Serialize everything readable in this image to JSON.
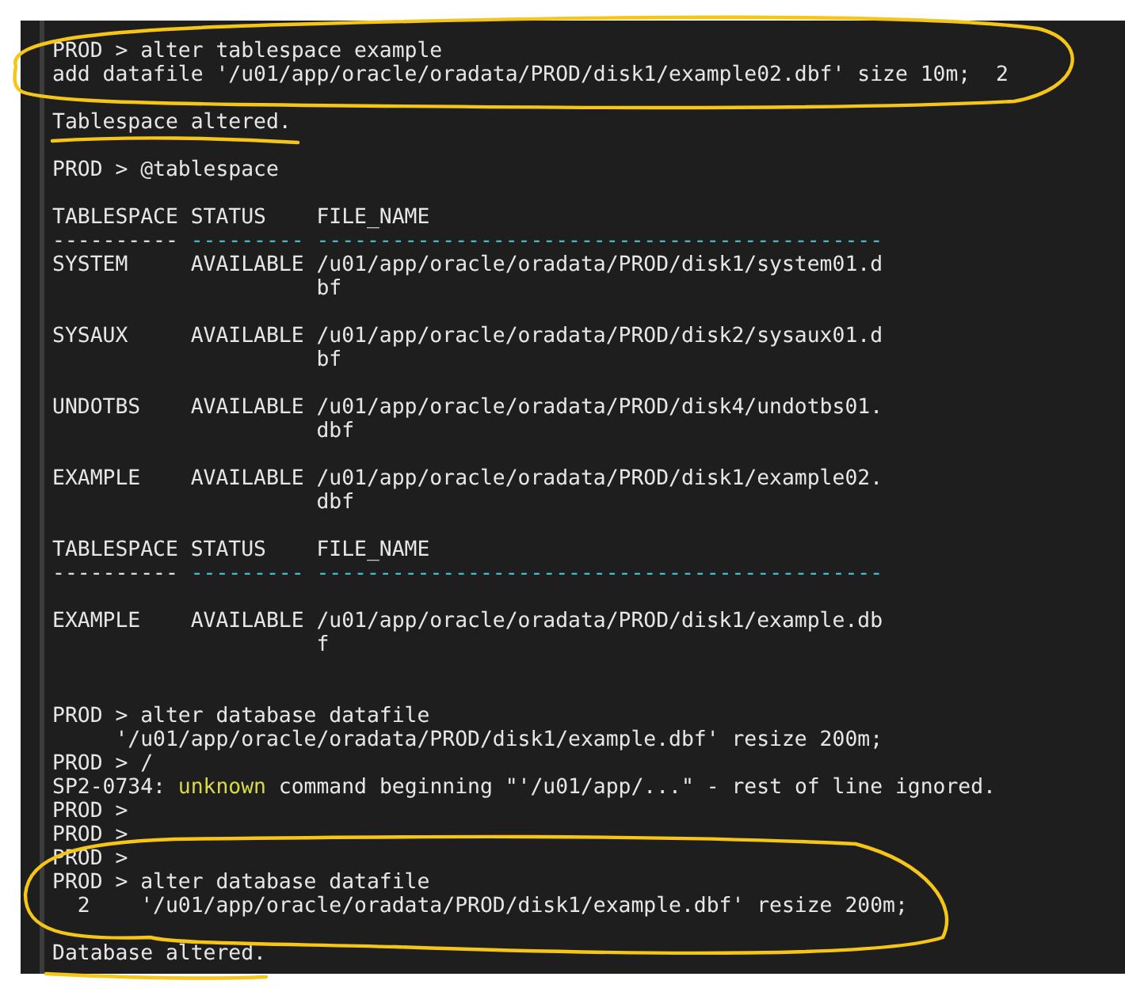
{
  "terminal": {
    "lines": [
      {
        "kind": "text",
        "text": "PROD > alter tablespace example"
      },
      {
        "kind": "text",
        "text": "add datafile '/u01/app/oracle/oradata/PROD/disk1/example02.dbf' size 10m;  2"
      },
      {
        "kind": "blank"
      },
      {
        "kind": "text",
        "text": "Tablespace altered."
      },
      {
        "kind": "blank"
      },
      {
        "kind": "text",
        "text": "PROD > @tablespace"
      },
      {
        "kind": "blank"
      },
      {
        "kind": "text",
        "text": "TABLESPACE STATUS    FILE_NAME"
      },
      {
        "kind": "segments",
        "segments": [
          {
            "kind": "plain",
            "text": "---------- "
          },
          {
            "kind": "accent",
            "text": "--------- ---------------------------------------------"
          }
        ]
      },
      {
        "kind": "text",
        "text": "SYSTEM     AVAILABLE /u01/app/oracle/oradata/PROD/disk1/system01.d"
      },
      {
        "kind": "text",
        "text": "                     bf"
      },
      {
        "kind": "blank"
      },
      {
        "kind": "text",
        "text": "SYSAUX     AVAILABLE /u01/app/oracle/oradata/PROD/disk2/sysaux01.d"
      },
      {
        "kind": "text",
        "text": "                     bf"
      },
      {
        "kind": "blank"
      },
      {
        "kind": "text",
        "text": "UNDOTBS    AVAILABLE /u01/app/oracle/oradata/PROD/disk4/undotbs01."
      },
      {
        "kind": "text",
        "text": "                     dbf"
      },
      {
        "kind": "blank"
      },
      {
        "kind": "text",
        "text": "EXAMPLE    AVAILABLE /u01/app/oracle/oradata/PROD/disk1/example02."
      },
      {
        "kind": "text",
        "text": "                     dbf"
      },
      {
        "kind": "blank"
      },
      {
        "kind": "text",
        "text": "TABLESPACE STATUS    FILE_NAME"
      },
      {
        "kind": "segments",
        "segments": [
          {
            "kind": "plain",
            "text": "---------- "
          },
          {
            "kind": "accent",
            "text": "--------- ---------------------------------------------"
          }
        ]
      },
      {
        "kind": "blank"
      },
      {
        "kind": "text",
        "text": "EXAMPLE    AVAILABLE /u01/app/oracle/oradata/PROD/disk1/example.db"
      },
      {
        "kind": "text",
        "text": "                     f"
      },
      {
        "kind": "blank"
      },
      {
        "kind": "blank"
      },
      {
        "kind": "text",
        "text": "PROD > alter database datafile"
      },
      {
        "kind": "text",
        "text": "     '/u01/app/oracle/oradata/PROD/disk1/example.dbf' resize 200m;"
      },
      {
        "kind": "text",
        "text": "PROD > /"
      },
      {
        "kind": "segments",
        "segments": [
          {
            "kind": "plain",
            "text": "SP2-0734: "
          },
          {
            "kind": "warning",
            "text": "unknown"
          },
          {
            "kind": "plain",
            "text": " command beginning \"'/u01/app/...\" - rest of line ignored."
          }
        ]
      },
      {
        "kind": "text",
        "text": "PROD >"
      },
      {
        "kind": "text",
        "text": "PROD >"
      },
      {
        "kind": "text",
        "text": "PROD >"
      },
      {
        "kind": "text",
        "text": "PROD > alter database datafile"
      },
      {
        "kind": "text",
        "text": "  2    '/u01/app/oracle/oradata/PROD/disk1/example.dbf' resize 200m;"
      },
      {
        "kind": "blank"
      },
      {
        "kind": "text",
        "text": "Database altered."
      }
    ]
  }
}
